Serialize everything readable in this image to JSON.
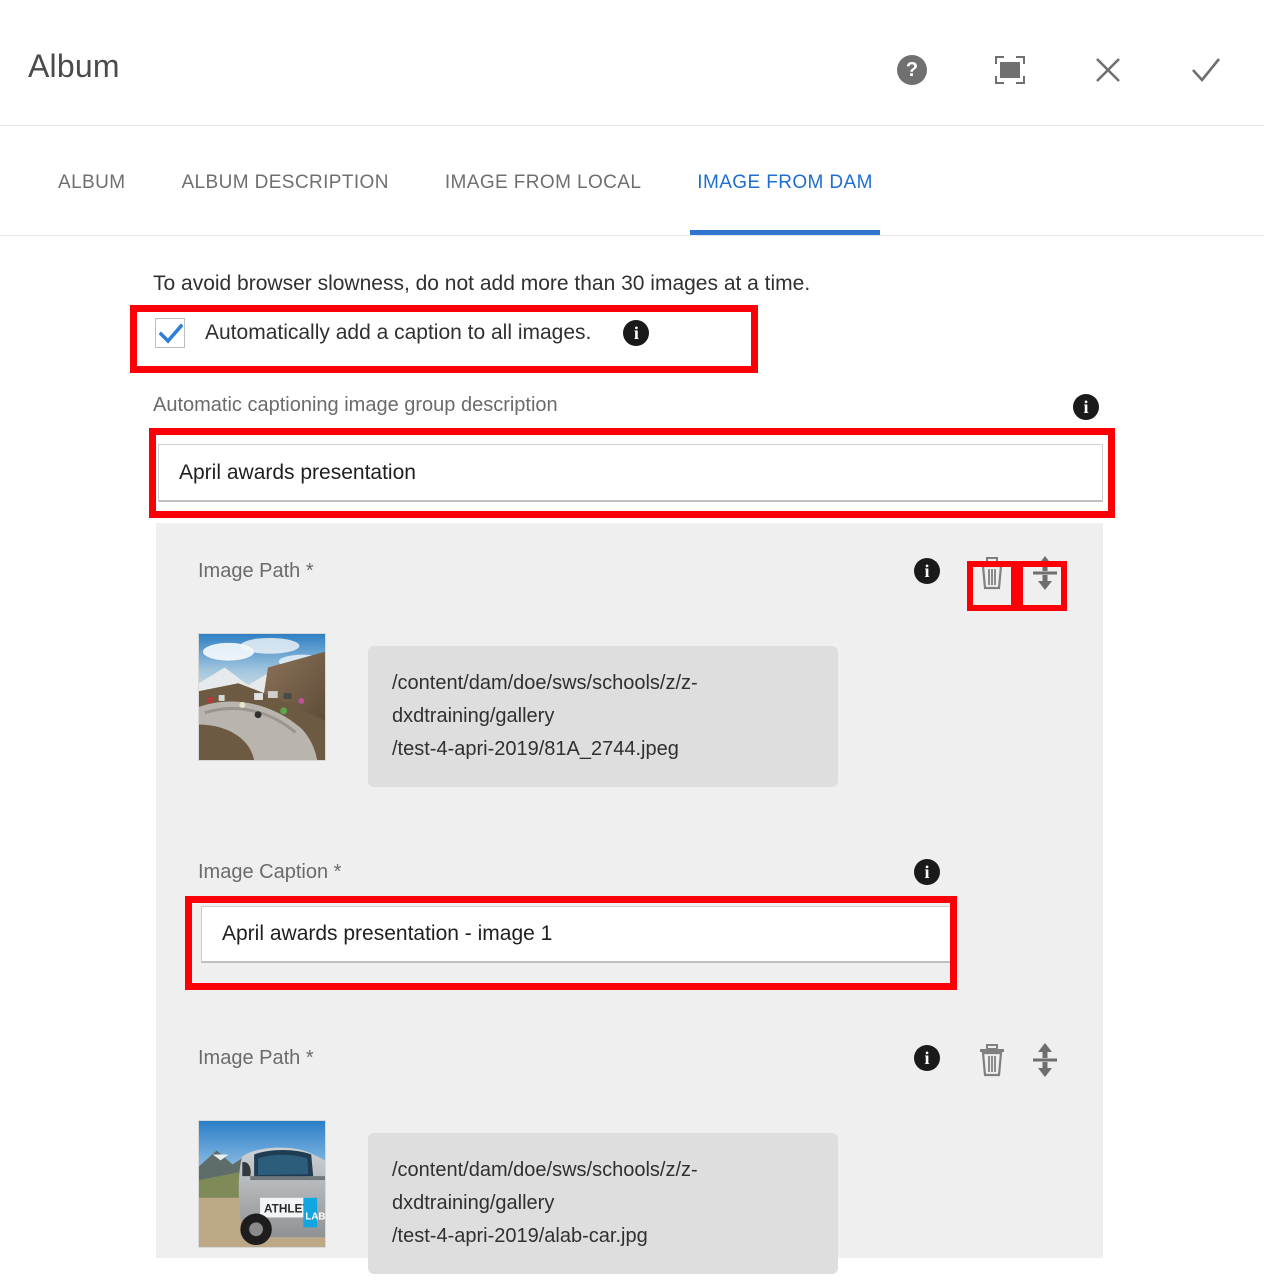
{
  "window": {
    "title": "Album",
    "actions": [
      {
        "name": "help-icon",
        "label": "?"
      },
      {
        "name": "fullscreen-icon",
        "label": "Fullscreen"
      },
      {
        "name": "close-icon",
        "label": "Close"
      },
      {
        "name": "done-icon",
        "label": "Done"
      }
    ]
  },
  "tabs": [
    {
      "label": "ALBUM",
      "active": false
    },
    {
      "label": "ALBUM DESCRIPTION",
      "active": false
    },
    {
      "label": "IMAGE FROM LOCAL",
      "active": false
    },
    {
      "label": "IMAGE FROM DAM",
      "active": true
    }
  ],
  "form": {
    "notice": "To avoid browser slowness, do not add more than 30 images at a time.",
    "auto_caption": {
      "label": "Automatically add a caption to all images.",
      "checked": true,
      "info": "i"
    },
    "group_description": {
      "label": "Automatic captioning image group description",
      "value": "April awards presentation",
      "placeholder": "",
      "info": "i"
    },
    "items": [
      {
        "path_label": "Image Path *",
        "path_value": "/content/dam/doe/sws/schools/z/z-dxdtraining/gallery/test-4-apri-2019/81A_2744.jpeg",
        "path_line1": "/content/dam/doe/sws/schools/z/z-dxdtraining/gallery",
        "path_line2": "/test-4-apri-2019/81A_2744.jpeg",
        "info": "i",
        "delete_label": "Delete",
        "move_label": "Move",
        "thumbnail_alt": "mountain-road-hairpin-with-cyclists",
        "caption_label": "Image Caption *",
        "caption_value": "April awards presentation - image 1",
        "caption_info": "i"
      },
      {
        "path_label": "Image Path *",
        "path_value": "/content/dam/doe/sws/schools/z/z-dxdtraining/gallery/test-4-apri-2019/alab-car.jpg",
        "path_line1": "/content/dam/doe/sws/schools/z/z-dxdtraining/gallery",
        "path_line2": "/test-4-apri-2019/alab-car.jpg",
        "info": "i",
        "delete_label": "Delete",
        "move_label": "Move",
        "thumbnail_alt": "athlete-lab-branded-car-in-mountains"
      }
    ]
  },
  "colors": {
    "accent": "#2f74cf",
    "annotation": "#fb0007",
    "panel": "#efefef",
    "path_chip": "#dedede",
    "label_gray": "#6b6b6b",
    "text": "#303030"
  },
  "annotations": [
    {
      "name": "auto-caption-checkbox"
    },
    {
      "name": "group-description-input"
    },
    {
      "name": "row-action-icons"
    },
    {
      "name": "image-caption-input"
    }
  ]
}
